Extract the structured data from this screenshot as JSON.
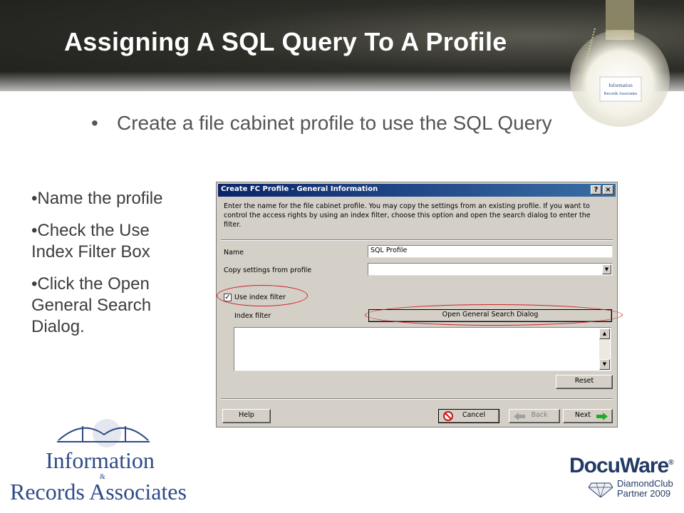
{
  "slide": {
    "title": "Assigning A SQL Query To A Profile",
    "main_bullet": "Create a file cabinet profile to use the SQL Query",
    "bullet_char": "•",
    "side_bullets": [
      "•Name the profile",
      "•Check the Use Index Filter Box",
      "•Click the Open General Search Dialog."
    ]
  },
  "dialog": {
    "title": "Create FC Profile - General Information",
    "help_glyph": "?",
    "close_glyph": "×",
    "intro": "Enter the name for the file cabinet profile. You may copy the settings from an existing profile. If you want to control the access rights by using an index filter, choose this option and open the search dialog to enter the filter.",
    "name_label": "Name",
    "name_value": "SQL Profile",
    "copy_label": "Copy settings from profile",
    "copy_value": "",
    "use_index_filter_label": "Use index filter",
    "use_index_filter_checked": true,
    "check_glyph": "✓",
    "index_filter_label": "Index filter",
    "open_search_button": "Open General Search Dialog",
    "reset_button": "Reset",
    "help_button": "Help",
    "cancel_button": "Cancel",
    "back_button": "Back",
    "next_button": "Next",
    "icons": [
      "help-icon",
      "close-icon",
      "chevron-down-icon",
      "scroll-up-icon",
      "scroll-down-icon",
      "cancel-icon",
      "back-arrow-icon",
      "next-arrow-icon"
    ]
  },
  "logos": {
    "ira_line1": "Information",
    "ira_amp": "&",
    "ira_line2": "Records Associates",
    "bulb_tag_1": "Information",
    "bulb_tag_2": "Records Associates",
    "docuware": "DocuWare",
    "docuware_reg": "®",
    "partner_line1": "DiamondClub",
    "partner_line2": "Partner 2009"
  },
  "colors": {
    "title_text": "#ffffff",
    "banner_dark": "#1d1d1a",
    "body_text": "#555555",
    "dialog_face": "#d4d0c8",
    "titlebar_start": "#0a246a",
    "titlebar_end": "#3a6ea5",
    "highlight_ellipse": "#d02020",
    "logo_blue": "#2e4a86",
    "next_arrow": "#22aa22"
  }
}
